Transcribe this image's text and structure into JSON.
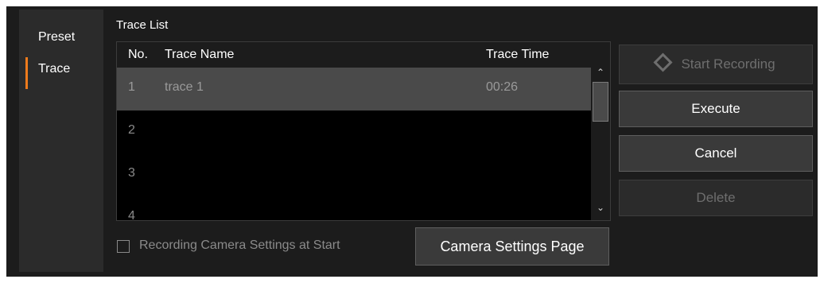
{
  "sidebar": {
    "tabs": [
      {
        "label": "Preset"
      },
      {
        "label": "Trace"
      }
    ],
    "active_tab": "Trace",
    "accent_color": "#ee7b1c"
  },
  "trace_list": {
    "title": "Trace List",
    "columns": {
      "no": "No.",
      "name": "Trace Name",
      "time": "Trace Time"
    },
    "rows": [
      {
        "no": "1",
        "name": "trace 1",
        "time": "00:26",
        "selected": true
      },
      {
        "no": "2",
        "name": "",
        "time": ""
      },
      {
        "no": "3",
        "name": "",
        "time": ""
      },
      {
        "no": "4",
        "name": "",
        "time": ""
      }
    ],
    "scroll_up_icon": "chevron-up-icon",
    "scroll_down_icon": "chevron-down-icon"
  },
  "options": {
    "record_camera_settings_label": "Recording Camera Settings at Start",
    "record_camera_settings_checked": false
  },
  "buttons": {
    "camera_settings": "Camera Settings Page",
    "start_recording": "Start Recording",
    "start_recording_icon": "diamond-icon",
    "execute": "Execute",
    "cancel": "Cancel",
    "delete": "Delete"
  }
}
